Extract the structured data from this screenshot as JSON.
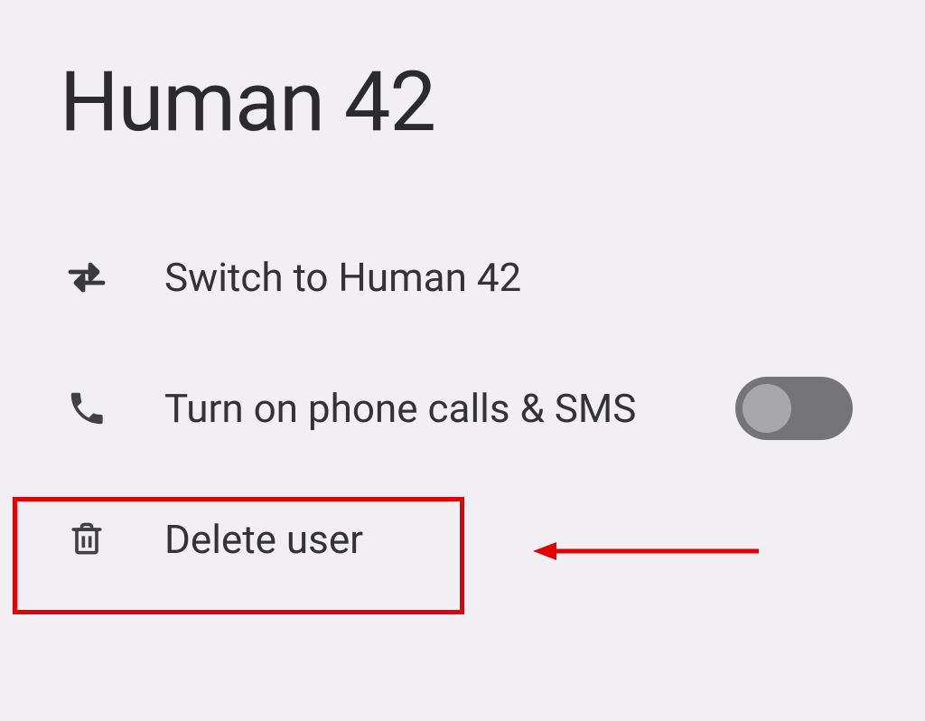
{
  "page": {
    "title": "Human 42"
  },
  "actions": {
    "switch": {
      "label": "Switch to Human 42"
    },
    "phone": {
      "label": "Turn on phone calls & SMS",
      "toggle_on": false
    },
    "delete": {
      "label": "Delete user"
    }
  },
  "annotations": {
    "highlight_color": "#e20202"
  }
}
